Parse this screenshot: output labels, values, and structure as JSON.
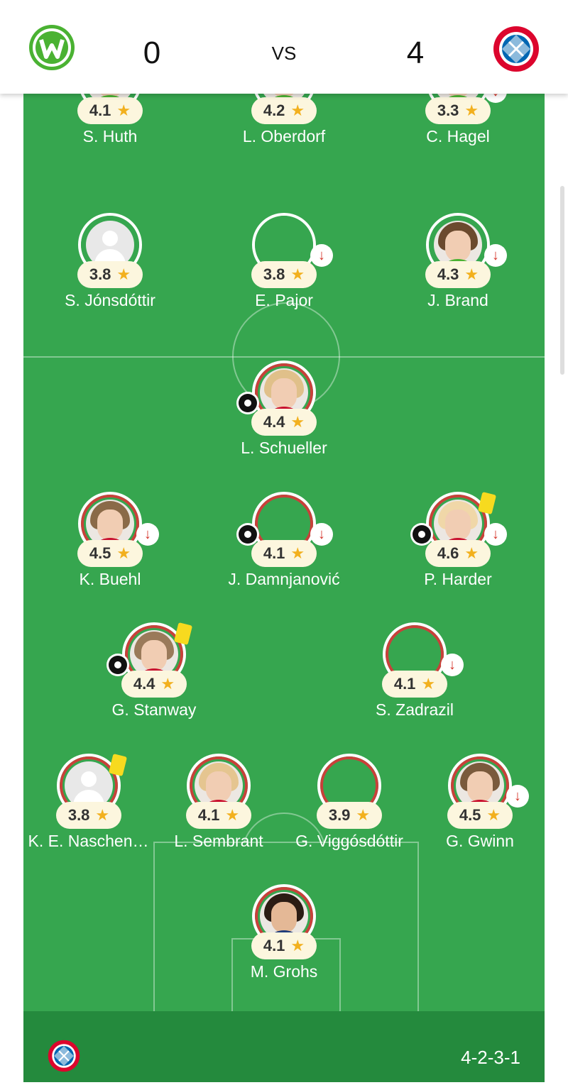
{
  "header": {
    "home_score": "0",
    "vs_label": "VS",
    "away_score": "4",
    "home_logo_icon": "wolfsburg-logo",
    "away_logo_icon": "bayern-munich-logo"
  },
  "colors": {
    "pitch": "#36a64f",
    "footer": "#248a3d",
    "home_ring": "#36a64f",
    "away_ring": "#c9403a",
    "rating_bg": "#fcf6de",
    "star": "#f2b01e",
    "sub_arrow": "#d5342a",
    "yellow_card": "#f7da1f"
  },
  "home_players": [
    {
      "name": "S. Huth",
      "rating": "4.1"
    },
    {
      "name": "L. Oberdorf",
      "rating": "4.2"
    },
    {
      "name": "C. Hagel",
      "rating": "3.3"
    },
    {
      "name": "S. Jónsdóttir",
      "rating": "3.8"
    },
    {
      "name": "E. Pajor",
      "rating": "3.8"
    },
    {
      "name": "J. Brand",
      "rating": "4.3"
    }
  ],
  "away_players": [
    {
      "name": "L. Schueller",
      "rating": "4.4"
    },
    {
      "name": "K. Buehl",
      "rating": "4.5"
    },
    {
      "name": "J. Damnjanović",
      "rating": "4.1"
    },
    {
      "name": "P. Harder",
      "rating": "4.6"
    },
    {
      "name": "G. Stanway",
      "rating": "4.4"
    },
    {
      "name": "S. Zadrazil",
      "rating": "4.1"
    },
    {
      "name": "K. E. Naschen…",
      "rating": "3.8"
    },
    {
      "name": "L. Sembrant",
      "rating": "4.1"
    },
    {
      "name": "G. Viggósdóttir",
      "rating": "3.9"
    },
    {
      "name": "G. Gwinn",
      "rating": "4.5"
    },
    {
      "name": "M. Grohs",
      "rating": "4.1"
    }
  ],
  "footer": {
    "formation": "4-2-3-1",
    "team_logo_icon": "bayern-munich-logo"
  }
}
